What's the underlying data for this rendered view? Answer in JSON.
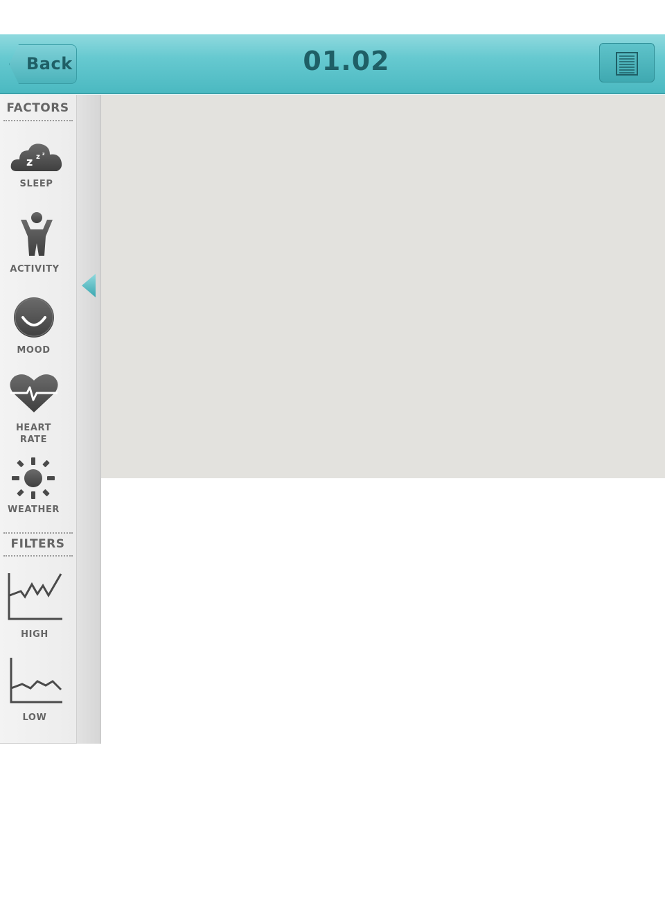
{
  "header": {
    "back_label": "Back",
    "title": "01.02",
    "list_icon": "list-icon"
  },
  "sidebar": {
    "factors_heading": "FACTORS",
    "factors": [
      {
        "label": "SLEEP",
        "icon": "sleep-cloud-icon"
      },
      {
        "label": "ACTIVITY",
        "icon": "activity-person-icon"
      },
      {
        "label": "MOOD",
        "icon": "mood-smiley-icon"
      },
      {
        "label": "HEART\nRATE",
        "icon": "heart-rate-icon"
      },
      {
        "label": "WEATHER",
        "icon": "sun-icon"
      }
    ],
    "filters_heading": "FILTERS",
    "filters": [
      {
        "label": "HIGH",
        "icon": "high-chart-icon"
      },
      {
        "label": "LOW",
        "icon": "low-chart-icon"
      }
    ]
  },
  "colors": {
    "accent": "#4bb9c1",
    "header_text": "#1f5f66",
    "icon_gray": "#555555",
    "content_bg": "#e3e2de"
  }
}
